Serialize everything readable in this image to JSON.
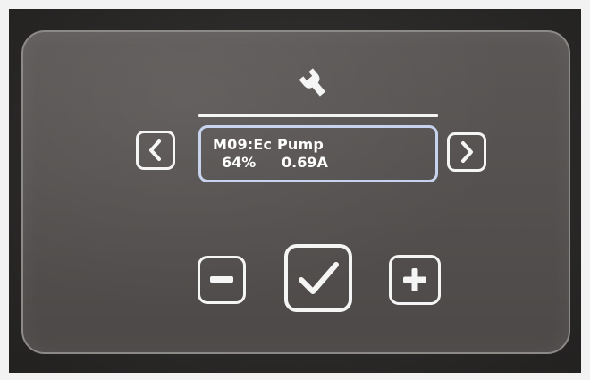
{
  "screen": {
    "header_icon": "wrench-icon",
    "motor_name": "M09:Ec Pump",
    "motor_percent": "64%",
    "motor_current": "0.69A"
  },
  "buttons": {
    "prev_icon": "chevron-left-icon",
    "next_icon": "chevron-right-icon",
    "decrease_icon": "minus-icon",
    "confirm_icon": "checkmark-icon",
    "increase_icon": "plus-icon"
  },
  "colors": {
    "glass": "#555150",
    "frame": "#2a2928",
    "foreground": "#f5f5f5",
    "display_border": "#c6d2ee"
  }
}
